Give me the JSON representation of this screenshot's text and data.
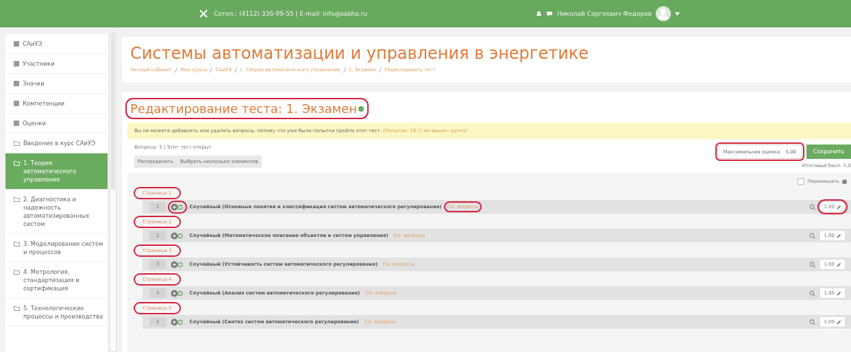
{
  "topbar": {
    "contact": "Сотел.: (4112) 336-99-55 | E-mail: info@sakha.ru",
    "user_name": "Николай Сергеевич Федоров"
  },
  "sidebar": {
    "items": [
      {
        "label": "САиУЭ",
        "kind": "link",
        "selected": false
      },
      {
        "label": "Участники",
        "kind": "link",
        "selected": false
      },
      {
        "label": "Значки",
        "kind": "link",
        "selected": false
      },
      {
        "label": "Компетенции",
        "kind": "link",
        "selected": false
      },
      {
        "label": "Оценки",
        "kind": "link",
        "selected": false
      },
      {
        "label": "Введение в курс САиУЭ",
        "kind": "section",
        "selected": false
      },
      {
        "label": "1. Теория автоматического управления",
        "kind": "section",
        "selected": true
      },
      {
        "label": "2. Диагностика и надежность автоматизированных систем",
        "kind": "section",
        "selected": false
      },
      {
        "label": "3. Моделирование систем и процессов",
        "kind": "section",
        "selected": false
      },
      {
        "label": "4. Метрология, стандартизация и сертификация",
        "kind": "section",
        "selected": false
      },
      {
        "label": "5. Технологические процессы и производства",
        "kind": "section",
        "selected": false
      }
    ]
  },
  "course_title": "Системы автоматизации и управления в энергетике",
  "breadcrumb": [
    "Личный кабинет",
    "Мои курсы",
    "САиУЭ",
    "1. Теория автоматического управления",
    "1. Экзамен",
    "Редактировать тест"
  ],
  "heading": {
    "text": "Редактирование теста: 1. Экзамен",
    "highlighted": true
  },
  "notice": {
    "text": "Вы не можете добавлять или удалять вопросы, потому что уже были попытки пройти этот тест.",
    "link": "(Попыток: 19 (1 из ваших групп))"
  },
  "summary": "Вопросы: 5 | Этот тест открыт",
  "buttons": [
    "Распределить",
    "Выбрать несколько элементов"
  ],
  "max_grade": {
    "label": "Максимальная оценка",
    "value": "5,00",
    "highlighted": true
  },
  "save_button": "Сохранить",
  "total": "Итоговый балл: 5,0",
  "shuffle": {
    "label": "Перемешать",
    "checked": false
  },
  "pages": [
    {
      "label": "Страница 1",
      "highlighted": true,
      "question": {
        "number": "1",
        "text": "Случайный (Основные понятия и классификация систем автоматического регулирования)",
        "link": "См. вопросы",
        "mark": "1,00",
        "icon_highlighted": true,
        "link_highlighted": true,
        "mark_highlighted": true
      }
    },
    {
      "label": "Страница 2",
      "highlighted": true,
      "question": {
        "number": "2",
        "text": "Случайный (Математическое описание объектов и систем управления)",
        "link": "См. вопросы",
        "mark": "1,00",
        "icon_highlighted": false,
        "link_highlighted": false,
        "mark_highlighted": false
      }
    },
    {
      "label": "Страница 3",
      "highlighted": true,
      "question": {
        "number": "3",
        "text": "Случайный (Устойчивость систем автоматического регулирования)",
        "link": "См. вопросы",
        "mark": "1,00",
        "icon_highlighted": false,
        "link_highlighted": false,
        "mark_highlighted": false
      }
    },
    {
      "label": "Страница 4",
      "highlighted": true,
      "question": {
        "number": "4",
        "text": "Случайный (Анализ систем автоматического регулирования)",
        "link": "См. вопросы",
        "mark": "1,00",
        "icon_highlighted": false,
        "link_highlighted": false,
        "mark_highlighted": false
      }
    },
    {
      "label": "Страница 5",
      "highlighted": true,
      "question": {
        "number": "5",
        "text": "Случайный (Синтез систем автоматического регулирования)",
        "link": "См. вопросы",
        "mark": "1,00",
        "icon_highlighted": false,
        "link_highlighted": false,
        "mark_highlighted": false
      }
    }
  ]
}
